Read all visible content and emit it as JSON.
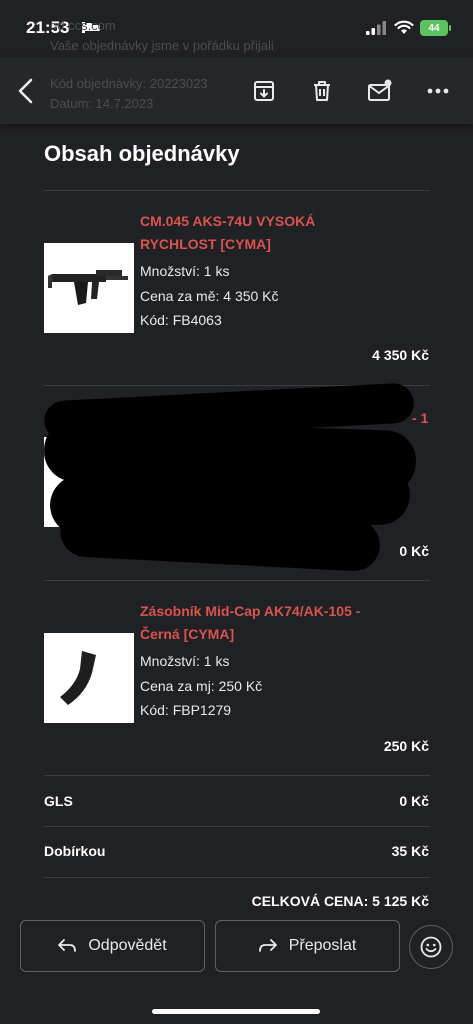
{
  "status_bar": {
    "time": "21:53",
    "battery": "44"
  },
  "background_text": {
    "line1": "od ccs.com",
    "line2": "Vaše objednávky jsme v pořádku přijali",
    "line3": "Kód objednávky: 20223023",
    "line4": "Datum: 14.7.2023"
  },
  "toolbar": {
    "back_icon": "chevron-left-icon",
    "archive_icon": "archive-icon",
    "delete_icon": "trash-icon",
    "unread_icon": "mail-unread-icon",
    "more_icon": "more-horizontal-icon"
  },
  "order": {
    "heading": "Obsah objednávky",
    "items": [
      {
        "name_line1": "CM.045 AKS-74U VYSOKÁ",
        "name_line2": "RYCHLOST [CYMA]",
        "quantity": "Množství: 1 ks",
        "unit_price": "Cena za mě: 4 350 Kč",
        "code": "Kód: FB4063",
        "total": "4 350 Kč"
      },
      {
        "name_partial": "- 1",
        "total_partial": "0 Kč"
      },
      {
        "name_line1": "Zásobník Mid-Cap AK74/AK-105 -",
        "name_line2": "Černá [CYMA]",
        "quantity": "Množství: 1 ks",
        "unit_price": "Cena za mj: 250 Kč",
        "code": "Kód: FBP1279",
        "total": "250 Kč"
      }
    ],
    "shipping_label": "GLS",
    "shipping_value": "0 Kč",
    "cod_label": "Dobírkou",
    "cod_value": "35 Kč",
    "grand_total": "CELKOVÁ CENA: 5 125 Kč"
  },
  "actions": {
    "reply": "Odpovědět",
    "forward": "Přeposlat",
    "emoji_icon": "emoji-reaction-icon"
  },
  "colors": {
    "background": "#202124",
    "product_link": "#d9534f"
  }
}
